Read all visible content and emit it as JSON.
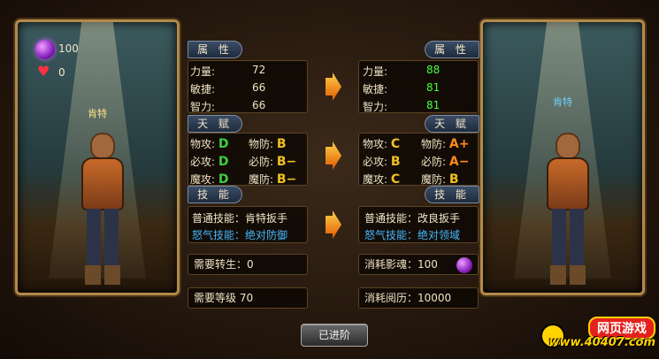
{
  "left_hero": {
    "orb_count": "100",
    "heart_count": "0",
    "name": "肯特"
  },
  "right_hero": {
    "name": "肯特"
  },
  "sections": {
    "attributes": "属 性",
    "talent": "天 赋",
    "skills": "技 能"
  },
  "left_attrs": [
    {
      "label": "力量:",
      "value": "72"
    },
    {
      "label": "敏捷:",
      "value": "66"
    },
    {
      "label": "智力:",
      "value": "66"
    }
  ],
  "right_attrs": [
    {
      "label": "力量:",
      "value": "88"
    },
    {
      "label": "敏捷:",
      "value": "81"
    },
    {
      "label": "智力:",
      "value": "81"
    }
  ],
  "left_talent": [
    {
      "label1": "物攻:",
      "grade1": "D",
      "label2": "物防:",
      "grade2": "B"
    },
    {
      "label1": "必攻:",
      "grade1": "D",
      "label2": "必防:",
      "grade2": "B−"
    },
    {
      "label1": "魔攻:",
      "grade1": "D",
      "label2": "魔防:",
      "grade2": "B−"
    }
  ],
  "right_talent": [
    {
      "label1": "物攻:",
      "grade1": "C",
      "label2": "物防:",
      "grade2": "A+"
    },
    {
      "label1": "必攻:",
      "grade1": "B",
      "label2": "必防:",
      "grade2": "A−"
    },
    {
      "label1": "魔攻:",
      "grade1": "C",
      "label2": "魔防:",
      "grade2": "B"
    }
  ],
  "left_skills": {
    "normal": "普通技能：肯特扳手",
    "rage": "怒气技能：绝对防御"
  },
  "right_skills": {
    "normal": "普通技能：改良扳手",
    "rage": "怒气技能：绝对领域"
  },
  "requirements": {
    "rebirth": "需要转生：0",
    "level": "需要等级  70",
    "soul_cost": "消耗影魂：100",
    "exp_cost": "消耗阅历：10000"
  },
  "advance_button": "已进阶",
  "watermark": {
    "top": "网页游戏",
    "bottom": "www.40407.com"
  },
  "colors": {
    "upgraded_value": "#42ff42",
    "rage_skill": "#45b8ff",
    "grade_D": "#3cd03c",
    "grade_B": "#f0c020",
    "grade_A": "#ff8a1a"
  }
}
